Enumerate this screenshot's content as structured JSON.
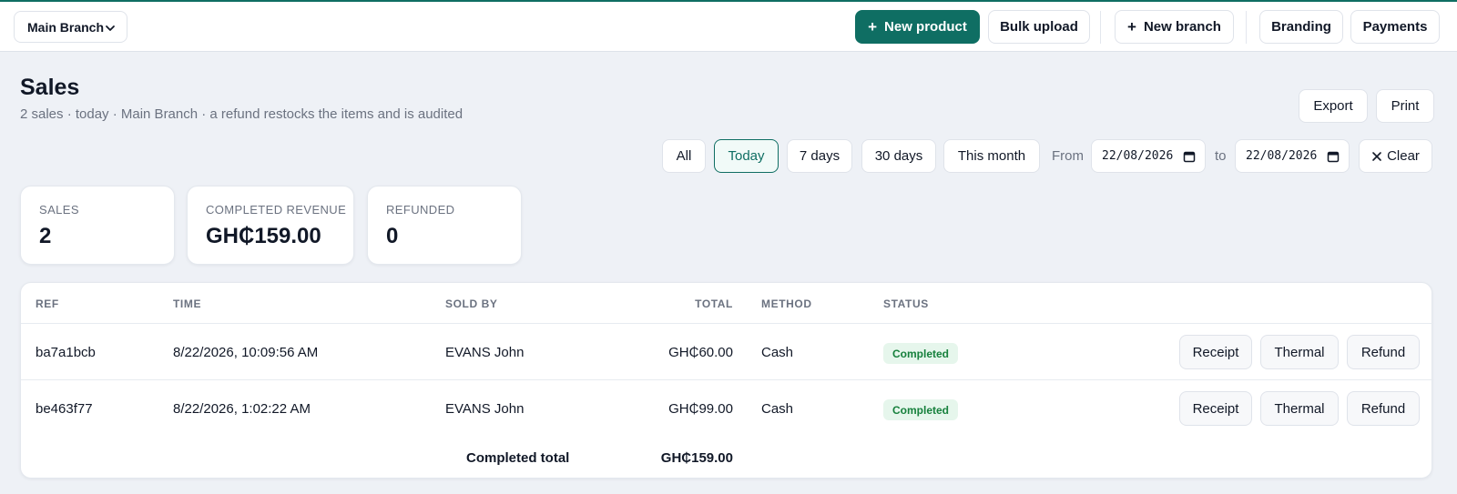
{
  "topbar": {
    "branch_select": "Main Branch",
    "new_product": "New product",
    "bulk_upload": "Bulk upload",
    "new_branch": "New branch",
    "branding": "Branding",
    "payments": "Payments"
  },
  "header": {
    "title": "Sales",
    "subtitle": "2 sales · today · Main Branch · a refund restocks the items and is audited",
    "export": "Export",
    "print": "Print"
  },
  "filters": {
    "all": "All",
    "today": "Today",
    "d7": "7 days",
    "d30": "30 days",
    "month": "This month",
    "from_label": "From",
    "from_value": "22/08/2026",
    "to_label": "to",
    "to_value": "22/08/2026",
    "clear": "Clear",
    "active": "Today"
  },
  "stats": [
    {
      "label": "SALES",
      "value": "2"
    },
    {
      "label": "COMPLETED REVENUE",
      "value": "GH₵159.00"
    },
    {
      "label": "REFUNDED",
      "value": "0"
    }
  ],
  "table": {
    "columns": {
      "ref": "REF",
      "time": "TIME",
      "sold_by": "SOLD BY",
      "total": "TOTAL",
      "method": "METHOD",
      "status": "STATUS"
    },
    "rows": [
      {
        "ref": "ba7a1bcb",
        "time": "8/22/2026, 10:09:56 AM",
        "sold_by": "EVANS John",
        "total": "GH₵60.00",
        "method": "Cash",
        "status": "Completed",
        "receipt": "Receipt",
        "thermal": "Thermal",
        "refund": "Refund"
      },
      {
        "ref": "be463f77",
        "time": "8/22/2026, 1:02:22 AM",
        "sold_by": "EVANS John",
        "total": "GH₵99.00",
        "method": "Cash",
        "status": "Completed",
        "receipt": "Receipt",
        "thermal": "Thermal",
        "refund": "Refund"
      }
    ],
    "footer": {
      "label": "Completed total",
      "value": "GH₵159.00"
    }
  },
  "colors": {
    "brand": "#0f6e63",
    "status_completed_bg": "#e6f6ec",
    "status_completed_text": "#16803c"
  }
}
